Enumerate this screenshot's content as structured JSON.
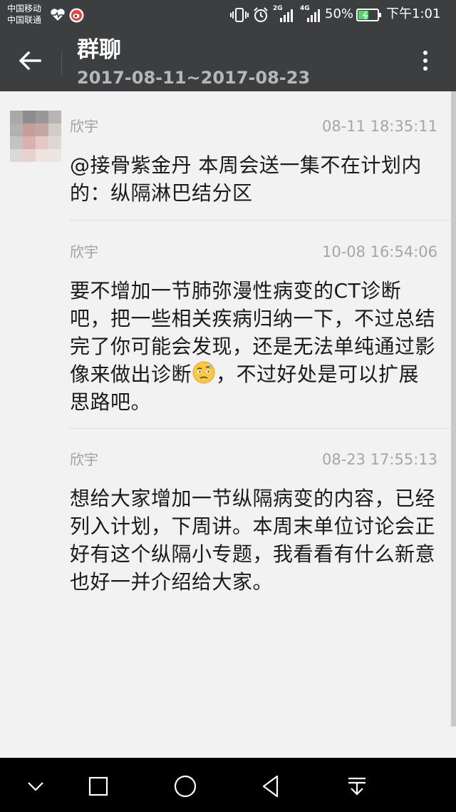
{
  "status_bar": {
    "carrier1": "中国移动",
    "carrier2": "中国联通",
    "battery": "50%",
    "time": "下午1:01",
    "network1": "2G",
    "network2": "4G",
    "icons": [
      "heart-rate-icon",
      "weibo-icon",
      "vibrate-icon",
      "alarm-icon",
      "signal-icon",
      "battery-icon"
    ]
  },
  "header": {
    "title": "群聊",
    "date_range": "2017-08-11~2017-08-23"
  },
  "messages": [
    {
      "sender": "欣宇",
      "time": "08-11 18:35:11",
      "text": "@接骨紫金丹 本周会送一集不在计划内的：纵隔淋巴结分区"
    },
    {
      "sender": "欣宇",
      "time": "10-08 16:54:06",
      "text_before_emoji": "要不增加一节肺弥漫性病变的CT诊断吧，把一些相关疾病归纳一下，不过总结完了你可能会发现，还是无法单纯通过影像来做出诊断",
      "emoji": "thinking-face-emoji",
      "text_after_emoji": "，不过好处是可以扩展思路吧。"
    },
    {
      "sender": "欣宇",
      "time": "08-23 17:55:13",
      "text": "想给大家增加一节纵隔病变的内容，已经列入计划，下周讲。本周末单位讨论会正好有这个纵隔小专题，我看看有什么新意也好一并介绍给大家。"
    }
  ],
  "nav_bar": {
    "icons": [
      "collapse-icon",
      "recent-apps-icon",
      "home-icon",
      "back-icon",
      "notifications-icon"
    ]
  },
  "colors": {
    "header_bg": "#3b3f42",
    "body_bg": "#f2f2f2",
    "meta_text": "#a0a0a0",
    "message_text": "#1a1a1a",
    "battery_fill": "#4cd964"
  }
}
